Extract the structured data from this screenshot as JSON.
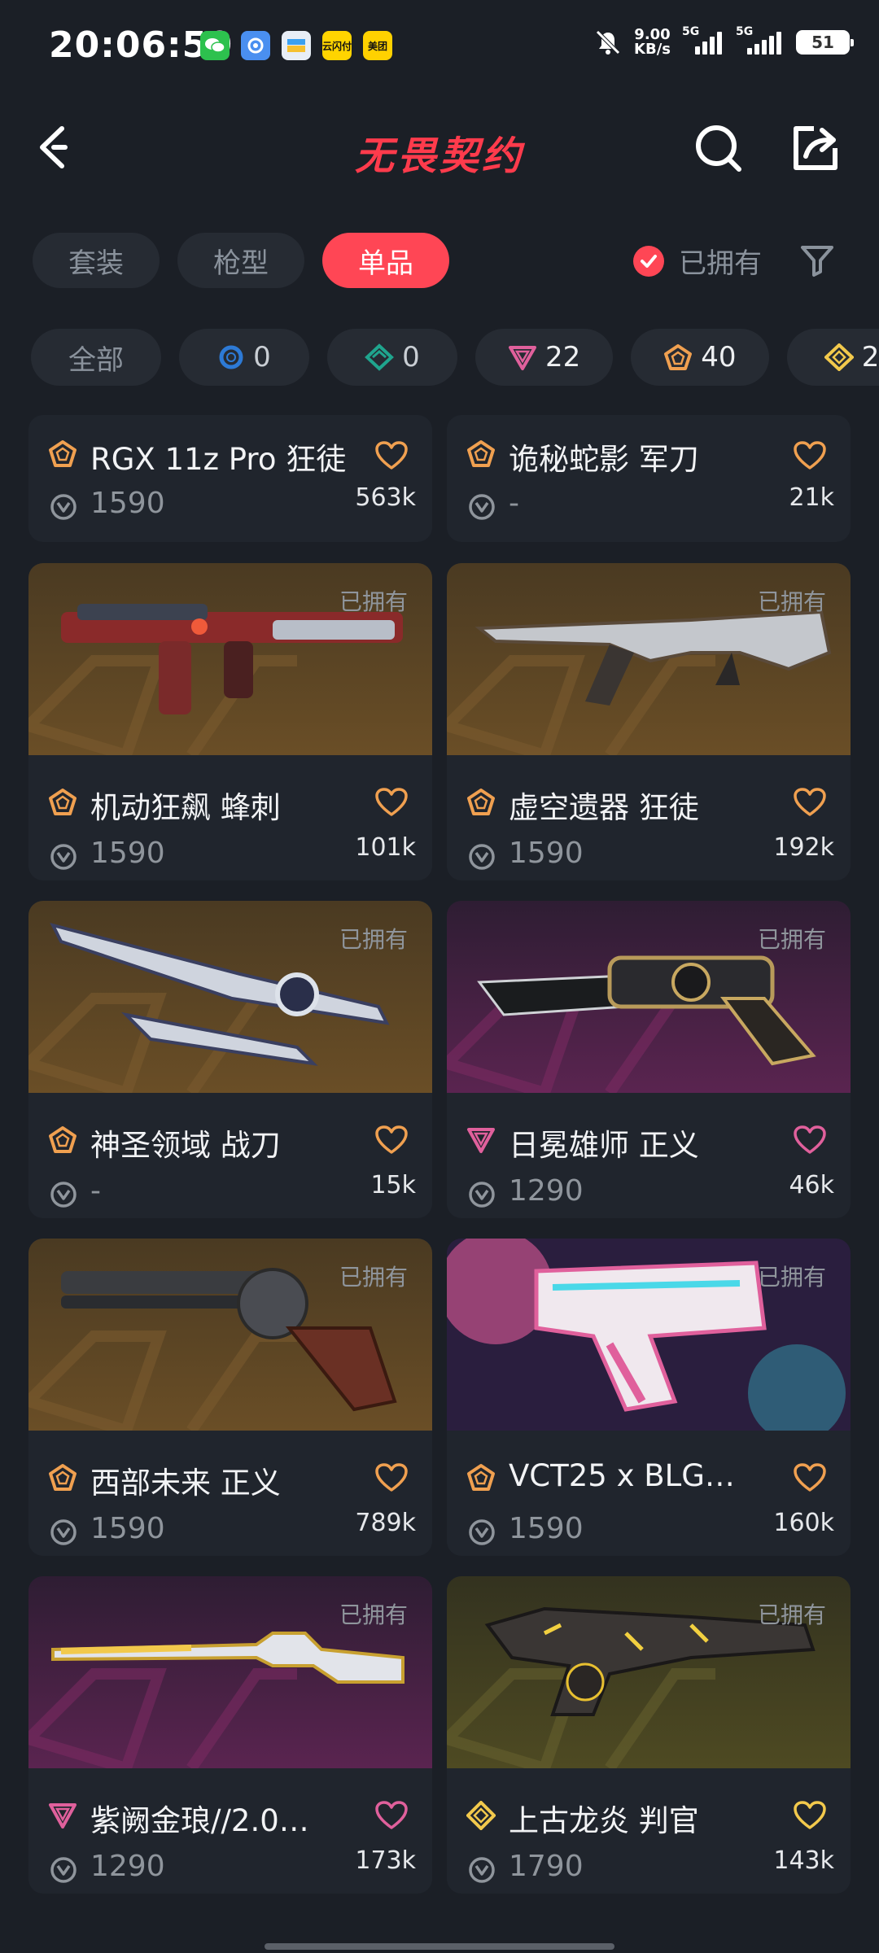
{
  "status_bar": {
    "time": "20:06:59",
    "net_speed_top": "9.00",
    "net_speed_bottom": "KB/s",
    "sim1": "5G",
    "sim2": "5G",
    "battery": "51",
    "apps": [
      "wechat-icon",
      "app-icon",
      "wallet-icon",
      "yunshanfu-icon",
      "meituan-icon"
    ],
    "app_labels": [
      "",
      "",
      "",
      "云闪付",
      "美团"
    ]
  },
  "header": {
    "title": "无畏契约"
  },
  "tabs": [
    {
      "label": "套装",
      "active": false
    },
    {
      "label": "枪型",
      "active": false
    },
    {
      "label": "单品",
      "active": true
    }
  ],
  "owned_filter": {
    "label": "已拥有",
    "checked": true
  },
  "tier_chips": [
    {
      "label": "全部",
      "count": ""
    },
    {
      "icon": "select-tier-icon",
      "count": "0"
    },
    {
      "icon": "deluxe-tier-icon",
      "count": "0"
    },
    {
      "icon": "premium-tier-icon",
      "count": "22"
    },
    {
      "icon": "exclusive-tier-icon",
      "count": "40"
    },
    {
      "icon": "ultra-tier-icon",
      "count": "2"
    }
  ],
  "colors": {
    "accent": "#ff4655",
    "premium": "#e0609c",
    "exclusive": "#f0a050",
    "ultra": "#f2c94c"
  },
  "cards": [
    {
      "name": "RGX 11z Pro 狂徒",
      "price": "1590",
      "likes": "563k",
      "tier": "exclusive",
      "owned_label": ""
    },
    {
      "name": "诡秘蛇影 军刀",
      "price": "-",
      "likes": "21k",
      "tier": "exclusive",
      "owned_label": ""
    },
    {
      "name": "机动狂飙 蜂刺",
      "price": "1590",
      "likes": "101k",
      "tier": "exclusive",
      "owned_label": "已拥有"
    },
    {
      "name": "虚空遗器 狂徒",
      "price": "1590",
      "likes": "192k",
      "tier": "exclusive",
      "owned_label": "已拥有"
    },
    {
      "name": "神圣领域 战刀",
      "price": "-",
      "likes": "15k",
      "tier": "exclusive",
      "owned_label": "已拥有"
    },
    {
      "name": "日冕雄师 正义",
      "price": "1290",
      "likes": "46k",
      "tier": "premium",
      "owned_label": "已拥有"
    },
    {
      "name": "西部未来 正义",
      "price": "1590",
      "likes": "789k",
      "tier": "exclusive",
      "owned_label": "已拥有"
    },
    {
      "name": "VCT25 x BLG…",
      "price": "1590",
      "likes": "160k",
      "tier": "exclusive",
      "owned_label": "已拥有"
    },
    {
      "name": "紫阙金琅//2.0…",
      "price": "1290",
      "likes": "173k",
      "tier": "premium",
      "owned_label": "已拥有"
    },
    {
      "name": "上古龙炎 判官",
      "price": "1790",
      "likes": "143k",
      "tier": "ultra",
      "owned_label": "已拥有"
    }
  ]
}
